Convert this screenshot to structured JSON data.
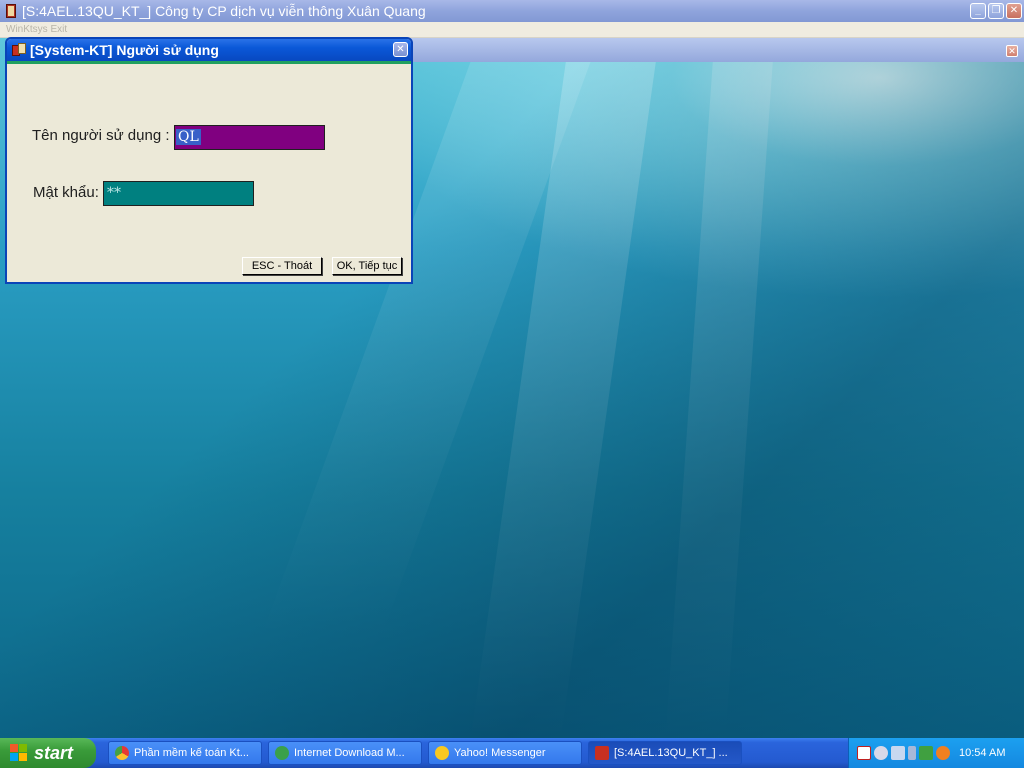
{
  "main_window": {
    "title": "[S:4AEL.13QU_KT_] Công ty CP dịch vụ viễn thông Xuân Quang",
    "controls": {
      "minimize": "_",
      "restore": "❐",
      "close": "✕"
    }
  },
  "menu_bar": {
    "text": "WinKtsys Exit"
  },
  "dialog": {
    "title": "[System-KT] Người sử dụng",
    "close": "✕",
    "username_label": "Tên người sử dụng :",
    "username_value": "QL",
    "password_label": "Mật khẩu:",
    "password_value": "**",
    "cancel_button": "ESC - Thoát",
    "ok_button": "OK, Tiếp tục"
  },
  "child_window": {
    "close": "✕"
  },
  "taskbar": {
    "start_label": "start",
    "tasks": [
      {
        "label": "Phần mềm kế toán Kt...",
        "icon": "chrome-icon"
      },
      {
        "label": "Internet Download M...",
        "icon": "download-manager-icon"
      },
      {
        "label": "Yahoo! Messenger",
        "icon": "yahoo-messenger-icon"
      },
      {
        "label": "[S:4AEL.13QU_KT_] ...",
        "icon": "app-icon"
      }
    ],
    "clock": "10:54 AM"
  },
  "colors": {
    "username_field_bg": "#800080",
    "password_field_bg": "#008080",
    "dialog_title_bg": "#0a58d8",
    "taskbar_bg": "#245ad0"
  }
}
